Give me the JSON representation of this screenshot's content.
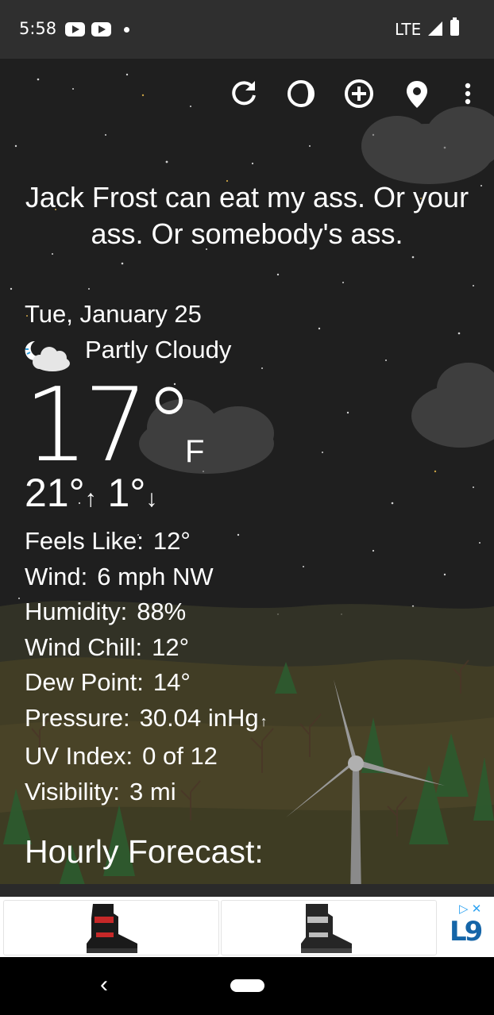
{
  "status_bar": {
    "time": "5:58",
    "network": "LTE"
  },
  "toolbar": {
    "icons": [
      "refresh-icon",
      "theme-icon",
      "add-location-icon",
      "location-pin-icon",
      "more-vert-icon"
    ]
  },
  "message": "Jack Frost can eat my ass. Or your ass. Or somebody's ass.",
  "current": {
    "date": "Tue, January 25",
    "condition": "Partly Cloudy",
    "temperature": "17°",
    "unit": "F",
    "high": "21°",
    "low": "1°"
  },
  "details": [
    {
      "label": "Feels Like:",
      "value": "12°"
    },
    {
      "label": "Wind:",
      "value": "6 mph NW"
    },
    {
      "label": "Humidity:",
      "value": "88%"
    },
    {
      "label": "Wind Chill:",
      "value": "12°"
    },
    {
      "label": "Dew Point:",
      "value": "14°"
    },
    {
      "label": "Pressure:",
      "value": "30.04 inHg"
    },
    {
      "label": "UV Index:",
      "value": "0 of 12"
    },
    {
      "label": "Visibility:",
      "value": "3 mi"
    }
  ],
  "hourly_title": "Hourly Forecast:",
  "ad": {
    "logo": "L9"
  },
  "colors": {
    "status_bar": "#2f2f2f",
    "background": "#1f1f1f",
    "ad_accent": "#2ea3f2"
  }
}
